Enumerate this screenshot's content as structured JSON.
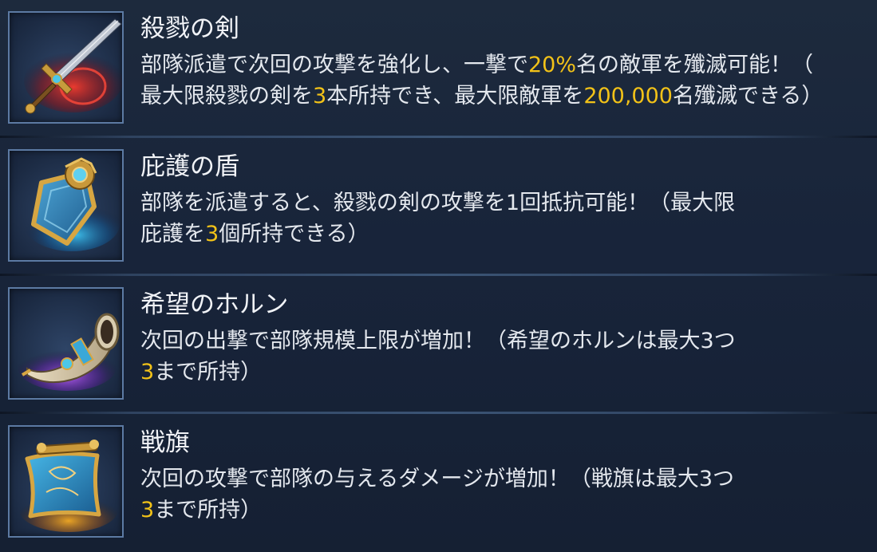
{
  "items": [
    {
      "name": "殺戮の剣",
      "icon": "sword-icon",
      "line1": {
        "a": "部隊派遣で次回の攻撃を強化し、一撃で",
        "hl": "20%",
        "b": "名の敵軍を殲滅可能！（"
      },
      "line2": {
        "a": "最大限殺戮の剣を",
        "hl1": "3",
        "b": "本所持でき、最大限敵軍を",
        "hl2": "200,000",
        "c": "名殲滅できる）"
      }
    },
    {
      "name": "庇護の盾",
      "icon": "shield-icon",
      "line1": "部隊を派遣すると、殺戮の剣の攻撃を1回抵抗可能！（最大限",
      "line2": {
        "a": "庇護を",
        "hl": "3",
        "b": "個所持できる）"
      }
    },
    {
      "name": "希望のホルン",
      "icon": "horn-icon",
      "line1": "次回の出撃で部隊規模上限が増加！（希望のホルンは最大3つ",
      "line2": {
        "hl": "3",
        "b": "まで所持）"
      }
    },
    {
      "name": "戦旗",
      "icon": "war-flag-icon",
      "line1": "次回の攻撃で部隊の与えるダメージが増加！（戦旗は最大3つ",
      "line2": {
        "hl": "3",
        "b": "まで所持）"
      }
    }
  ],
  "colors": {
    "highlight": "#f2c218",
    "background": "#1a2638",
    "frame": "#5c7aa3"
  }
}
